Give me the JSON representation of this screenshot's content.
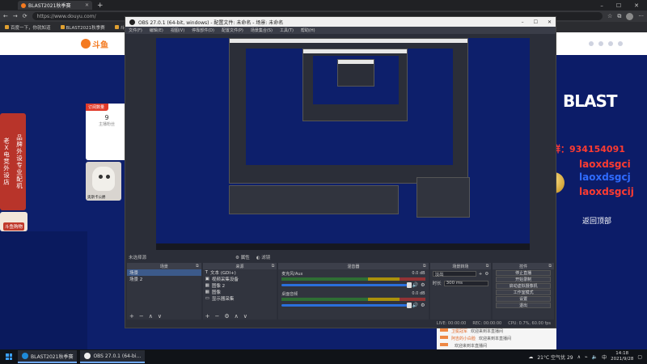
{
  "browser": {
    "tab_title": "BLAST2021秋季赛",
    "url": "https://www.douyu.com/",
    "bookmarks": [
      "百度一下，你就知道",
      "BLAST2021秋季赛",
      "斗鱼 - 每"
    ]
  },
  "site": {
    "logo_text": "斗鱼",
    "left_banner_col1": "老Ｘ电竞外设店",
    "left_banner_col2": "品牌外设专业配机",
    "left_gift_label": "斗鱼购物",
    "subscribe": {
      "header": "订阅数量",
      "count": "9",
      "label": "主播粉丝"
    },
    "cat_caption": "奥斯卡公爵",
    "right_blast": "BLAST",
    "overlay_lines": [
      "水友群：934154091",
      "laoxdsgci",
      "laoxdsgcj",
      "laoxdsgcij"
    ],
    "back_to_top": "返回顶部",
    "bottom_list": [
      {
        "name": "卫冕冠军",
        "msg": "欢迎来到本直播间"
      },
      {
        "name": "阿吉的小白脸",
        "msg": "欢迎来到本直播间"
      },
      {
        "name": "",
        "msg": "欢迎来到本直播间"
      }
    ]
  },
  "obs": {
    "title": "OBS 27.0.1 (64-bit, windows) - 配置文件: 未命名 - 场景: 未命名",
    "menu": [
      "文件(F)",
      "编辑(E)",
      "视图(V)",
      "停靠部件(D)",
      "配置文件(P)",
      "场景集合(S)",
      "工具(T)",
      "帮助(H)"
    ],
    "no_source_selected": "未选择源",
    "properties": "属性",
    "filters": "滤镜",
    "docks": {
      "scenes": {
        "title": "场景",
        "items": [
          "场景",
          "场景 2"
        ]
      },
      "sources": {
        "title": "来源",
        "items": [
          "文本 (GDI+)",
          "视频采集设备",
          "图像 2",
          "图像",
          "显示器采集"
        ]
      },
      "mixer": {
        "title": "混音器",
        "channels": [
          {
            "name": "麦克风/Aux",
            "db": "0.0 dB"
          },
          {
            "name": "桌面音频",
            "db": "0.0 dB"
          }
        ]
      },
      "transitions": {
        "title": "场景转场",
        "type": "淡出",
        "duration_label": "时长",
        "duration": "300 ms"
      },
      "controls": {
        "title": "控件",
        "buttons": [
          "停止直播",
          "开始录制",
          "启动虚拟摄像机",
          "工作室模式",
          "设置",
          "退出"
        ]
      }
    },
    "status": {
      "live": "LIVE: 00:00:00",
      "rec": "REC: 00:00:00",
      "cpu": "CPU: 0.7%, 60.00 fps"
    }
  },
  "taskbar": {
    "apps": [
      "BLAST2021秋季赛",
      "OBS 27.0.1 (64-bi..."
    ],
    "weather": "21°C 空气优 29",
    "lang": "中",
    "time": "14:18",
    "date": "2021/9/28"
  }
}
